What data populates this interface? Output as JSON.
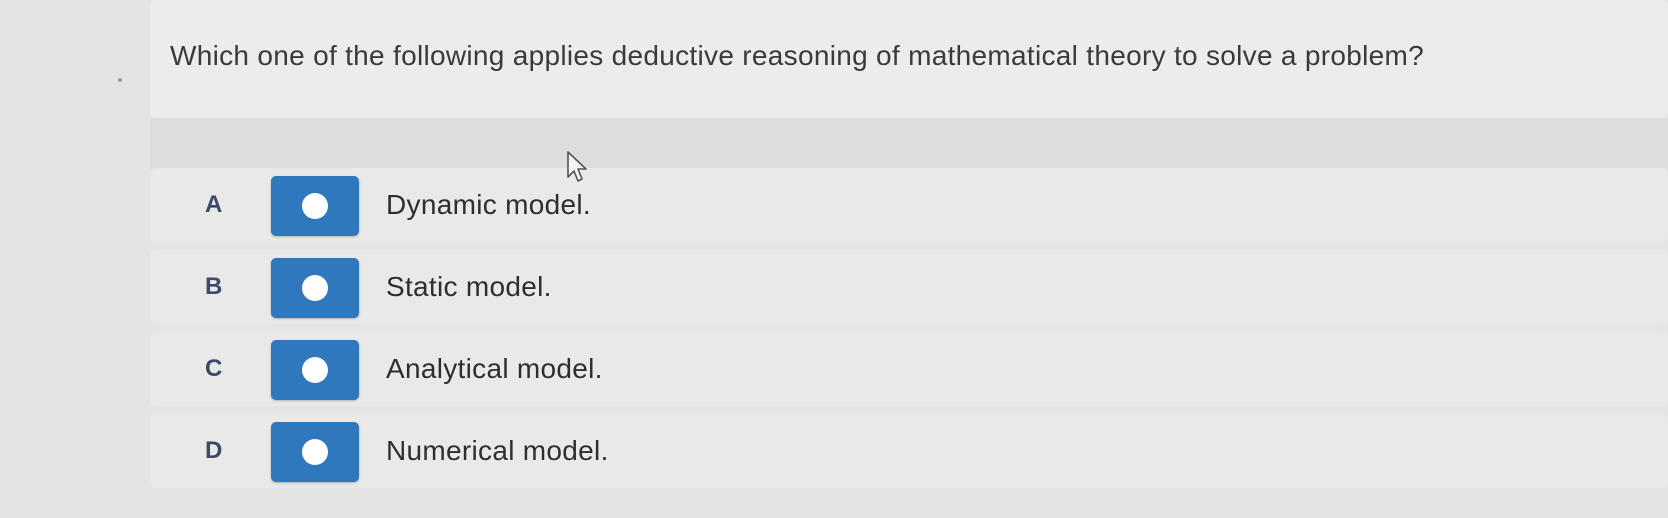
{
  "question": {
    "text": "Which one of the following applies deductive reasoning of mathematical theory to solve a problem?"
  },
  "options": [
    {
      "letter": "A",
      "text": "Dynamic model."
    },
    {
      "letter": "B",
      "text": "Static model."
    },
    {
      "letter": "C",
      "text": "Analytical model."
    },
    {
      "letter": "D",
      "text": "Numerical model."
    }
  ],
  "colors": {
    "radio_button": "#2f78bd",
    "letter": "#3b4a6b",
    "text": "#2e2e30"
  },
  "icons": {
    "cursor": "mouse-pointer-arrow",
    "radio": "radio-dot"
  }
}
